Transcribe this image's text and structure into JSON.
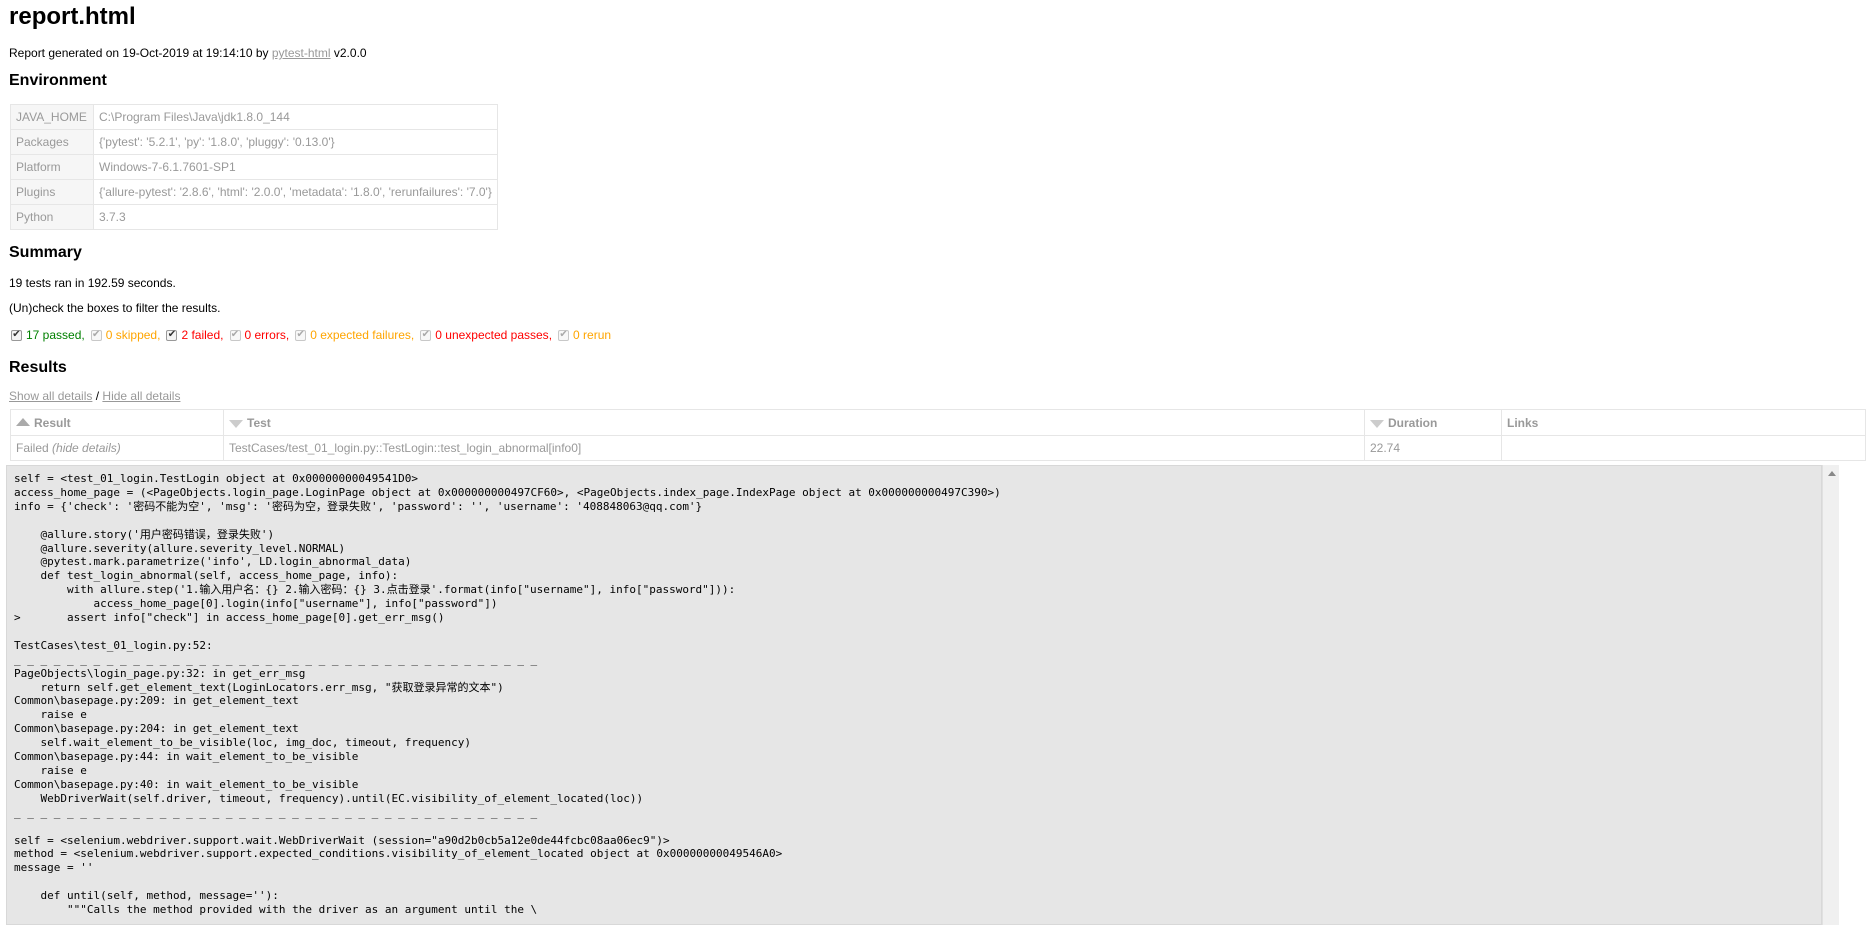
{
  "title": "report.html",
  "generated": {
    "prefix": "Report generated on 19-Oct-2019 at 19:14:10 by ",
    "link": "pytest-html",
    "suffix": " v2.0.0"
  },
  "environment": {
    "heading": "Environment",
    "rows": [
      {
        "key": "JAVA_HOME",
        "value": "C:\\Program Files\\Java\\jdk1.8.0_144"
      },
      {
        "key": "Packages",
        "value": "{'pytest': '5.2.1', 'py': '1.8.0', 'pluggy': '0.13.0'}"
      },
      {
        "key": "Platform",
        "value": "Windows-7-6.1.7601-SP1"
      },
      {
        "key": "Plugins",
        "value": "{'allure-pytest': '2.8.6', 'html': '2.0.0', 'metadata': '1.8.0', 'rerunfailures': '7.0'}"
      },
      {
        "key": "Python",
        "value": "3.7.3"
      }
    ]
  },
  "summary": {
    "heading": "Summary",
    "line": "19 tests ran in 192.59 seconds.",
    "uncheck": "(Un)check the boxes to filter the results.",
    "filters": [
      {
        "label": "17 passed",
        "cls": "passed",
        "checked": true,
        "disabled": false
      },
      {
        "label": "0 skipped",
        "cls": "skipped",
        "checked": true,
        "disabled": true
      },
      {
        "label": "2 failed",
        "cls": "failed",
        "checked": true,
        "disabled": false
      },
      {
        "label": "0 errors",
        "cls": "error",
        "checked": true,
        "disabled": true
      },
      {
        "label": "0 expected failures",
        "cls": "xfailed",
        "checked": true,
        "disabled": true
      },
      {
        "label": "0 unexpected passes",
        "cls": "xpassed",
        "checked": true,
        "disabled": true
      },
      {
        "label": "0 rerun",
        "cls": "rerun",
        "checked": true,
        "disabled": true
      }
    ],
    "filter_sep": ","
  },
  "results": {
    "heading": "Results",
    "show_all": "Show all details",
    "slash": " / ",
    "hide_all": "Hide all details",
    "columns": {
      "result": "Result",
      "test": "Test",
      "duration": "Duration",
      "links": "Links"
    },
    "row": {
      "result": "Failed",
      "toggle": "(hide details)",
      "test": "TestCases/test_01_login.py::TestLogin::test_login_abnormal[info0]",
      "duration": "22.74",
      "links": ""
    },
    "log_lines": [
      "self = <test_01_login.TestLogin object at 0x00000000049541D0>",
      "access_home_page = (<PageObjects.login_page.LoginPage object at 0x000000000497CF60>, <PageObjects.index_page.IndexPage object at 0x000000000497C390>)",
      "info = {'check': '密码不能为空', 'msg': '密码为空，登录失败', 'password': '', 'username': '408848063@qq.com'}",
      "",
      "    @allure.story('用户密码错误，登录失败')",
      "    @allure.severity(allure.severity_level.NORMAL)",
      "    @pytest.mark.parametrize('info', LD.login_abnormal_data)",
      "    def test_login_abnormal(self, access_home_page, info):",
      "        with allure.step('1.输入用户名：{} 2.输入密码：{} 3.点击登录'.format(info[\"username\"], info[\"password\"])):",
      "            access_home_page[0].login(info[\"username\"], info[\"password\"])",
      ">       assert info[\"check\"] in access_home_page[0].get_err_msg()",
      "",
      "TestCases\\test_01_login.py:52:",
      "_ _ _ _ _ _ _ _ _ _ _ _ _ _ _ _ _ _ _ _ _ _ _ _ _ _ _ _ _ _ _ _ _ _ _ _ _ _ _ _",
      "PageObjects\\login_page.py:32: in get_err_msg",
      "    return self.get_element_text(LoginLocators.err_msg, \"获取登录异常的文本\")",
      "Common\\basepage.py:209: in get_element_text",
      "    raise e",
      "Common\\basepage.py:204: in get_element_text",
      "    self.wait_element_to_be_visible(loc, img_doc, timeout, frequency)",
      "Common\\basepage.py:44: in wait_element_to_be_visible",
      "    raise e",
      "Common\\basepage.py:40: in wait_element_to_be_visible",
      "    WebDriverWait(self.driver, timeout, frequency).until(EC.visibility_of_element_located(loc))",
      "_ _ _ _ _ _ _ _ _ _ _ _ _ _ _ _ _ _ _ _ _ _ _ _ _ _ _ _ _ _ _ _ _ _ _ _ _ _ _ _",
      "",
      "self = <selenium.webdriver.support.wait.WebDriverWait (session=\"a90d2b0cb5a12e0de44fcbc08aa06ec9\")>",
      "method = <selenium.webdriver.support.expected_conditions.visibility_of_element_located object at 0x00000000049546A0>",
      "message = ''",
      "",
      "    def until(self, method, message=''):",
      "        \"\"\"Calls the method provided with the driver as an argument until the \\"
    ]
  }
}
